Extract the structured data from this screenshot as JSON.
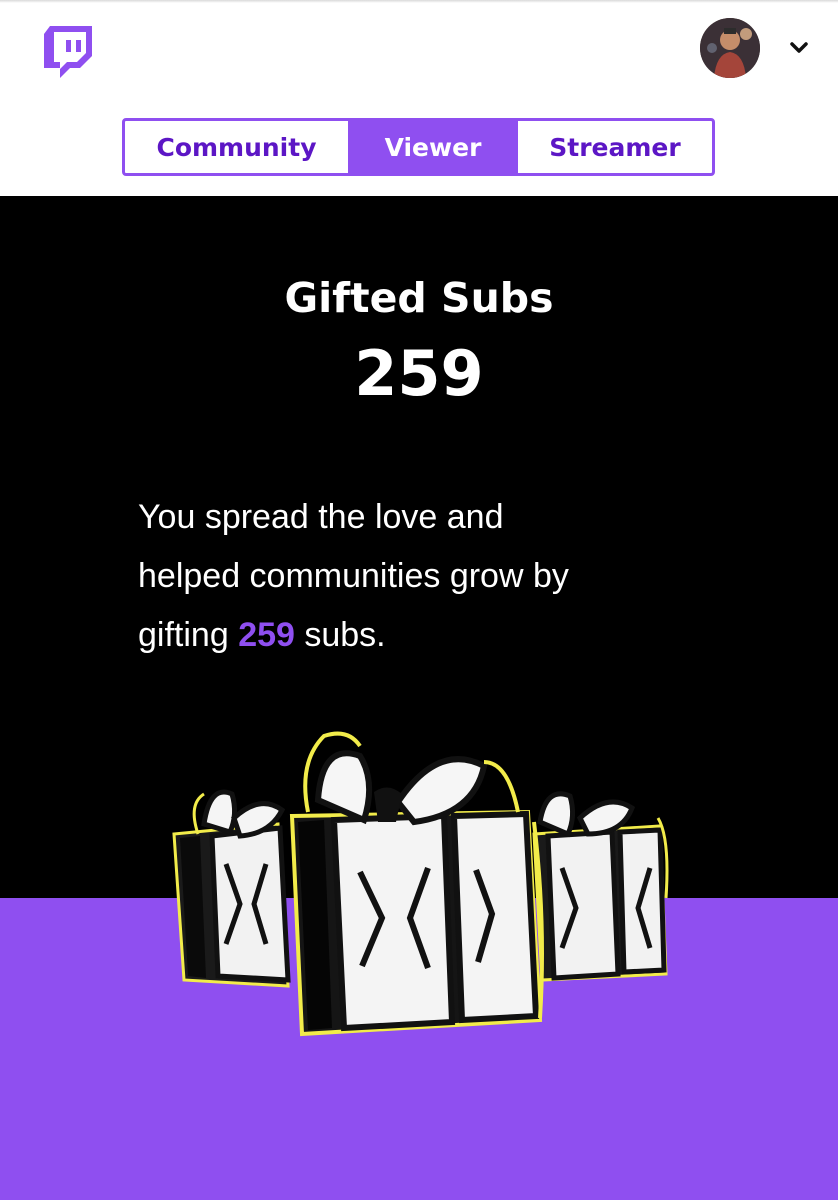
{
  "header": {
    "logo_icon": "twitch-logo-icon",
    "avatar_icon": "user-avatar",
    "menu_icon": "chevron-down-icon"
  },
  "tabs": [
    {
      "label": "Community",
      "active": false
    },
    {
      "label": "Viewer",
      "active": true
    },
    {
      "label": "Streamer",
      "active": false
    }
  ],
  "stat": {
    "title": "Gifted Subs",
    "value": "259"
  },
  "description": {
    "line1": "You spread the love and",
    "line2": "helped communities grow by",
    "line3_prefix": "gifting ",
    "line3_highlight": "259",
    "line3_suffix": " subs."
  },
  "illustration": {
    "icon": "gift-boxes-icon"
  },
  "colors": {
    "brand_purple": "#8f4ff0",
    "dark_purple_text": "#5c16c5",
    "background": "#000000",
    "gift_outline_yellow": "#f2ec4a"
  }
}
